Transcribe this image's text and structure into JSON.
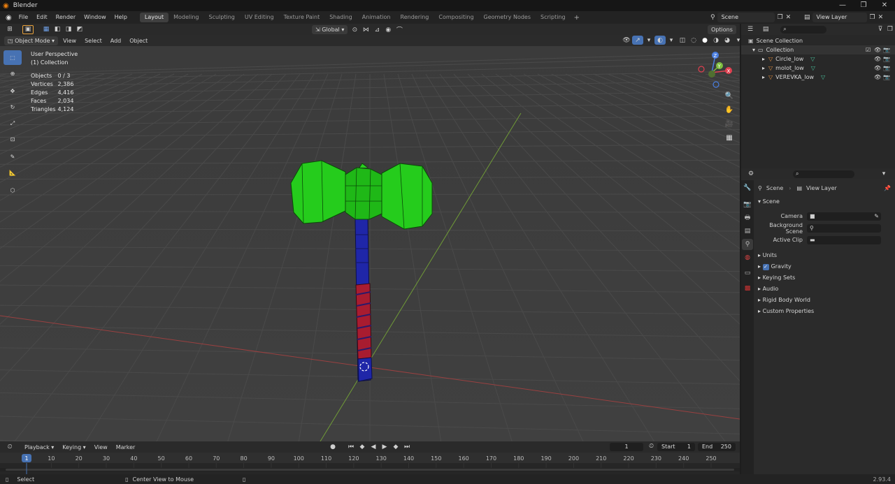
{
  "app": {
    "title": "Blender",
    "version": "2.93.4"
  },
  "window_controls": {
    "minimize": "—",
    "maximize": "❐",
    "close": "✕"
  },
  "menus": [
    "File",
    "Edit",
    "Render",
    "Window",
    "Help"
  ],
  "workspaces": [
    "Layout",
    "Modeling",
    "Sculpting",
    "UV Editing",
    "Texture Paint",
    "Shading",
    "Animation",
    "Rendering",
    "Compositing",
    "Geometry Nodes",
    "Scripting"
  ],
  "active_workspace": "Layout",
  "scene": {
    "name": "Scene",
    "view_layer": "View Layer"
  },
  "header": {
    "transform_orientation": "Global",
    "options": "Options"
  },
  "viewport_header": {
    "mode": "Object Mode",
    "menus": [
      "View",
      "Select",
      "Add",
      "Object"
    ]
  },
  "viewport": {
    "perspective": "User Perspective",
    "collection": "(1) Collection",
    "stats": [
      {
        "label": "Objects",
        "value": "0 / 3"
      },
      {
        "label": "Vertices",
        "value": "2,386"
      },
      {
        "label": "Edges",
        "value": "4,416"
      },
      {
        "label": "Faces",
        "value": "2,034"
      },
      {
        "label": "Triangles",
        "value": "4,124"
      }
    ],
    "gizmo": {
      "x": "X",
      "y": "Y",
      "z": "Z"
    }
  },
  "outliner": {
    "root": "Scene Collection",
    "collection": "Collection",
    "items": [
      "Circle_low",
      "molot_low",
      "VEREVKA_low"
    ]
  },
  "properties": {
    "breadcrumb_scene": "Scene",
    "breadcrumb_layer": "View Layer",
    "section": "Scene",
    "fields": [
      {
        "label": "Camera"
      },
      {
        "label": "Background Scene"
      },
      {
        "label": "Active Clip"
      }
    ],
    "subsections": [
      "Units",
      "Gravity",
      "Keying Sets",
      "Audio",
      "Rigid Body World",
      "Custom Properties"
    ],
    "gravity_checked": true
  },
  "timeline": {
    "menus": [
      "Playback",
      "Keying",
      "View",
      "Marker"
    ],
    "current_frame": "1",
    "start_label": "Start",
    "start": "1",
    "end_label": "End",
    "end": "250",
    "ruler": [
      "10",
      "20",
      "30",
      "40",
      "50",
      "60",
      "70",
      "80",
      "90",
      "100",
      "110",
      "120",
      "130",
      "140",
      "150",
      "160",
      "170",
      "180",
      "190",
      "200",
      "210",
      "220",
      "230",
      "240",
      "250"
    ],
    "playhead": "1"
  },
  "statusbar": {
    "left": "Select",
    "middle": "Center View to Mouse"
  },
  "colors": {
    "accent": "#4772b3",
    "hammer_head": "#22c81a",
    "handle": "#1d23a0",
    "grip": "#a01c2c"
  }
}
